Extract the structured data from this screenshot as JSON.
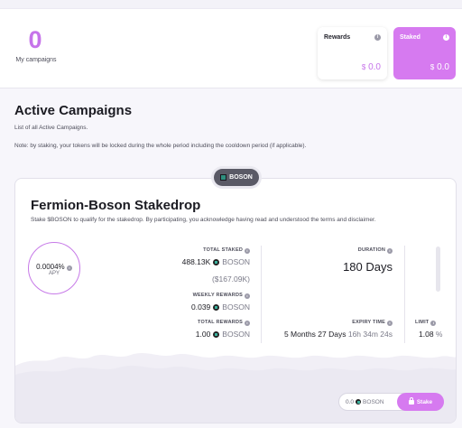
{
  "header": {
    "my_campaigns_count": "0",
    "my_campaigns_label": "My campaigns",
    "rewards": {
      "title": "Rewards",
      "currency": "$",
      "value": "0.0"
    },
    "staked": {
      "title": "Staked",
      "currency": "$",
      "value": "0.0"
    }
  },
  "section": {
    "title": "Active Campaigns",
    "subtitle": "List of all Active Campaigns.",
    "note": "Note: by staking, your tokens will be locked during the whole period including the cooldown period (if applicable)."
  },
  "token_pill": "BOSON",
  "campaign": {
    "title": "Fermion-Boson Stakedrop",
    "description": "Stake $BOSON to qualify for the stakedrop. By participating, you acknowledge having read and understood the terms and disclaimer.",
    "apy_value": "0.0004%",
    "apy_label": "APY",
    "total_staked_label": "TOTAL STAKED",
    "total_staked_value": "488.13K",
    "total_staked_token": "BOSON",
    "total_staked_usd": "($167.09K)",
    "weekly_rewards_label": "WEEKLY REWARDS",
    "weekly_rewards_value": "0.039",
    "weekly_rewards_token": "BOSON",
    "total_rewards_label": "TOTAL REWARDS",
    "total_rewards_value": "1.00",
    "total_rewards_token": "BOSON",
    "duration_label": "DURATION",
    "duration_value": "180 Days",
    "expiry_label": "EXPIRY TIME",
    "expiry_value_main": "5 Months 27 Days",
    "expiry_value_time": "16h 34m 24s",
    "limit_label": "LIMIT",
    "limit_value": "1.08",
    "limit_unit": "%",
    "stake_amount": "0.0",
    "stake_token": "BOSON",
    "stake_button": "Stake"
  },
  "colors": {
    "accent": "#d67af0",
    "accent_text": "#c674ea",
    "token_pill_bg": "#5a5a66"
  }
}
